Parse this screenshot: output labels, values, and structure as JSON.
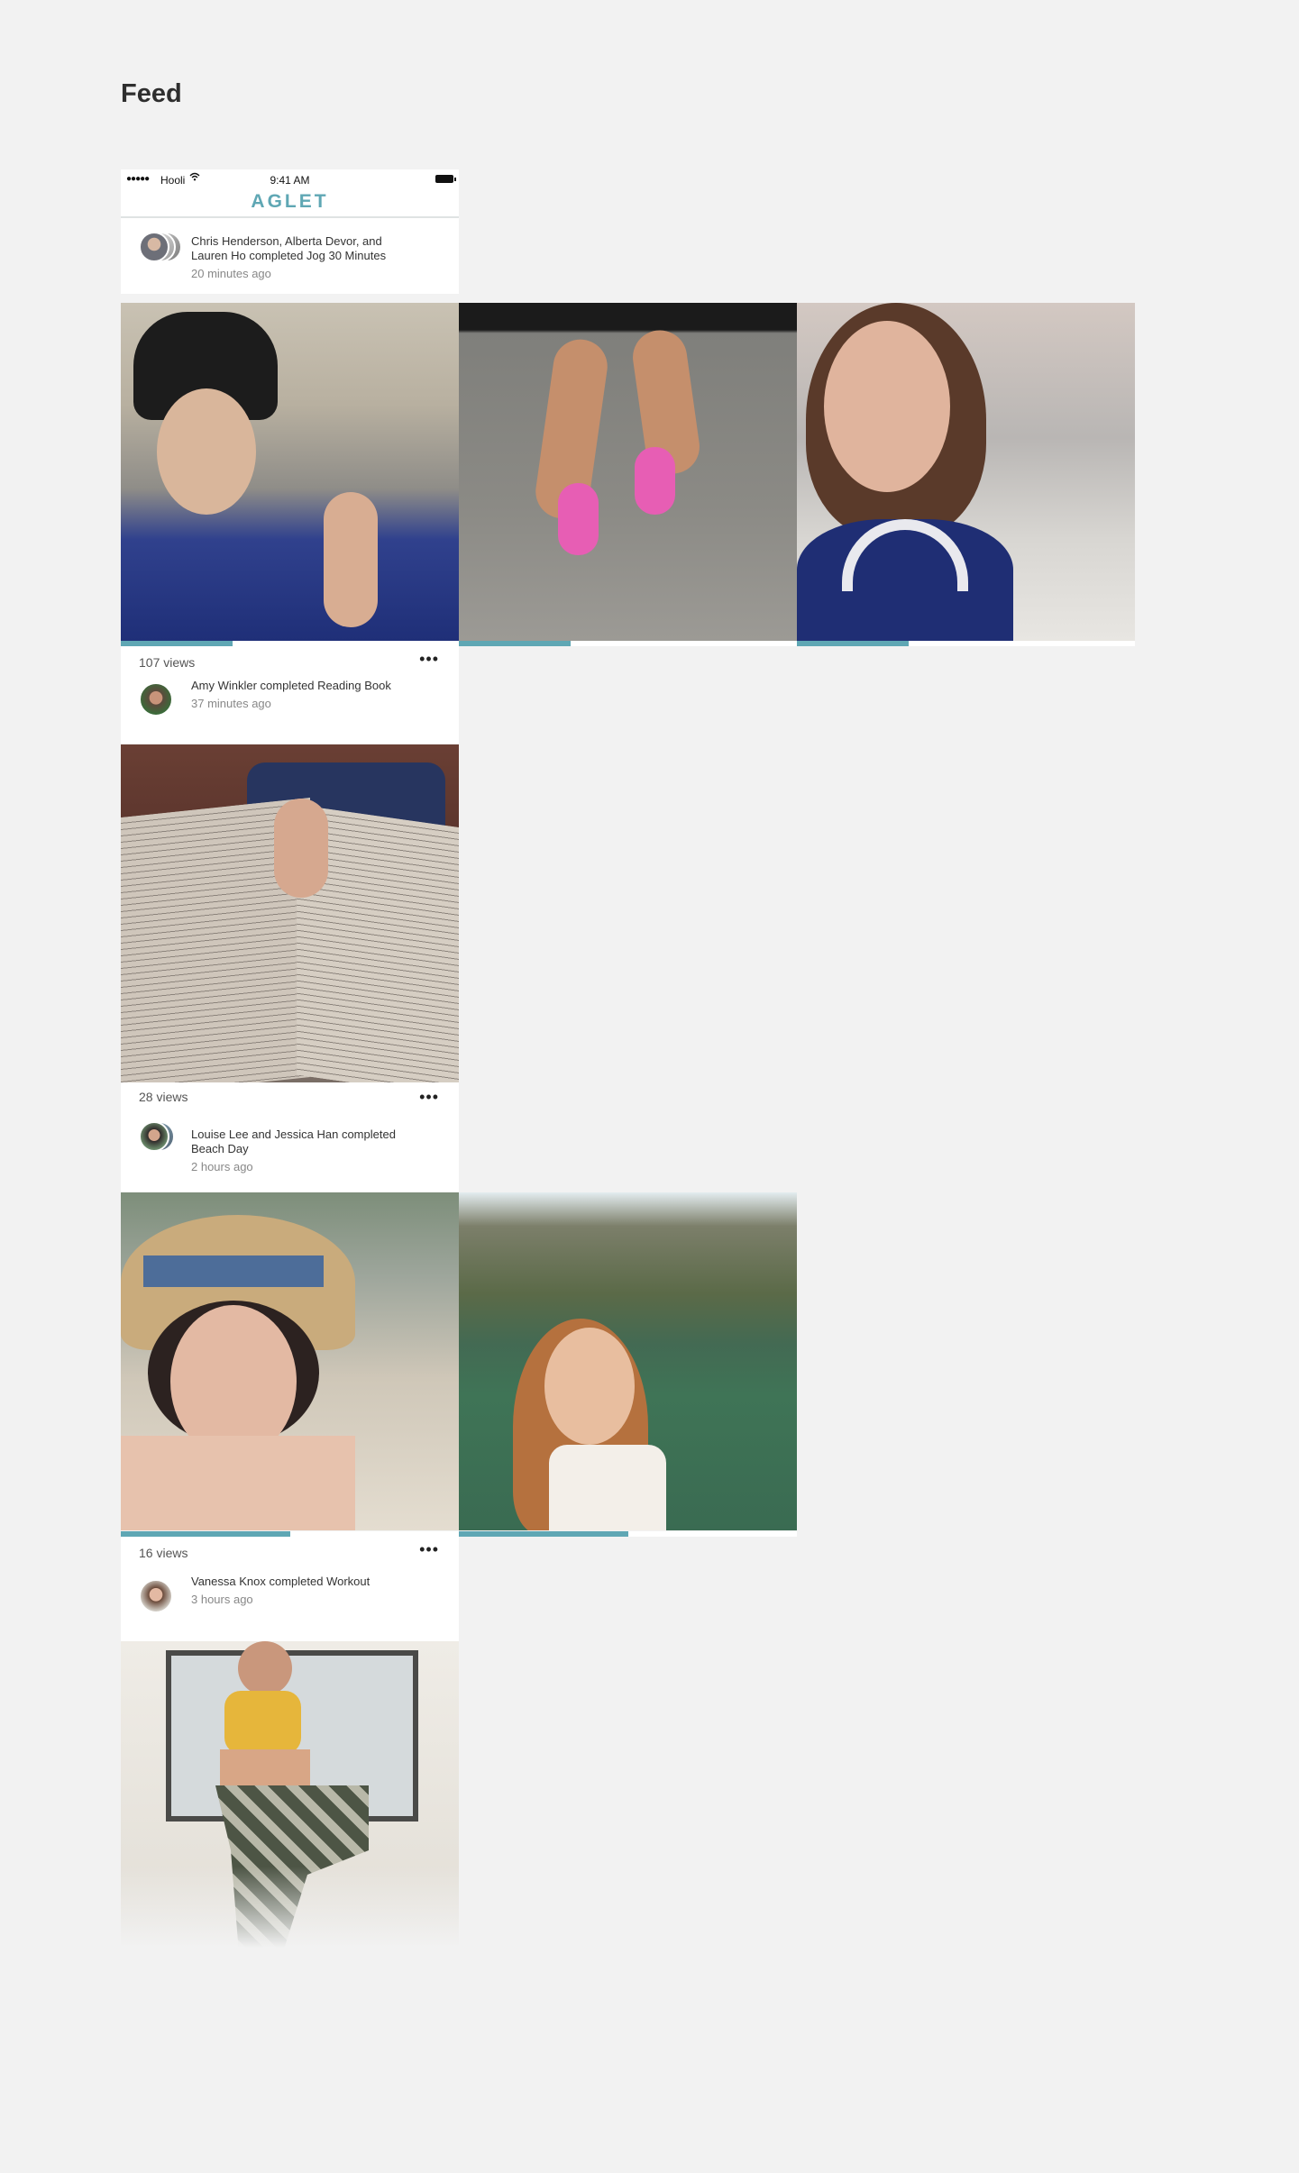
{
  "page": {
    "title": "Feed"
  },
  "status_bar": {
    "signal": "●●●●●",
    "carrier": "Hooli",
    "time": "9:41 AM"
  },
  "app": {
    "name": "AGLET"
  },
  "posts": [
    {
      "text": "Chris Henderson, Alberta Devor, and Lauren Ho completed Jog 30 Minutes",
      "time": "20 minutes ago",
      "views": "107 views",
      "photo_count": 3,
      "progress": [
        0.33,
        0.33,
        0.33
      ]
    },
    {
      "text": "Amy Winkler completed Reading Book",
      "time": "37 minutes ago",
      "views": "28 views",
      "photo_count": 1
    },
    {
      "text": "Louise Lee and Jessica Han completed Beach Day",
      "time": "2 hours ago",
      "views": "16 views",
      "photo_count": 2,
      "progress": [
        0.5,
        0.5
      ]
    },
    {
      "text": "Vanessa Knox completed Workout",
      "time": "3 hours ago",
      "photo_count": 1
    }
  ],
  "icons": {
    "more": "more-horizontal-icon",
    "wifi": "wifi-icon",
    "battery": "battery-icon"
  },
  "colors": {
    "accent": "#5fa7b4",
    "background": "#f2f2f2"
  }
}
